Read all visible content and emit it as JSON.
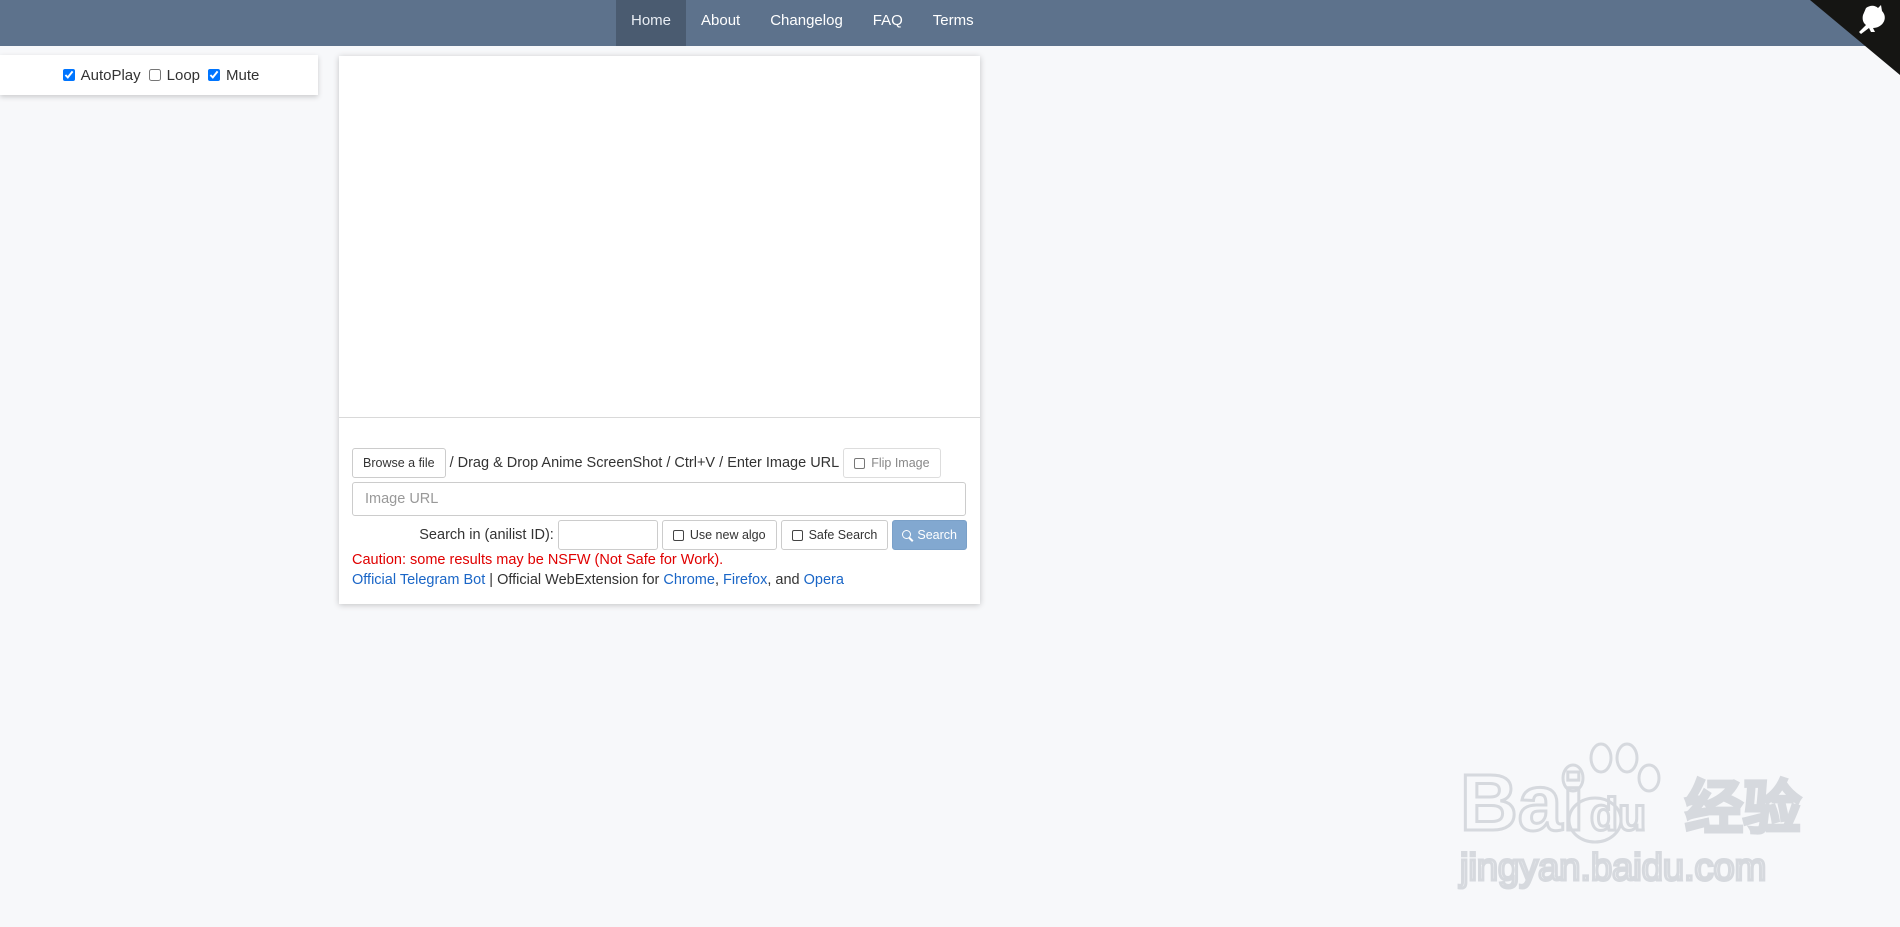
{
  "nav": {
    "items": [
      {
        "label": "Home",
        "active": true
      },
      {
        "label": "About"
      },
      {
        "label": "Changelog"
      },
      {
        "label": "FAQ"
      },
      {
        "label": "Terms"
      }
    ]
  },
  "player_options": {
    "autoplay_label": "AutoPlay",
    "autoplay_checked": true,
    "loop_label": "Loop",
    "loop_checked": false,
    "mute_label": "Mute",
    "mute_checked": true
  },
  "search": {
    "browse_label": "Browse a file",
    "instructions": "/ Drag & Drop Anime ScreenShot / Ctrl+V / Enter Image URL",
    "flip_label": "Flip Image",
    "url_placeholder": "Image URL",
    "anilist_label": "Search in (anilist ID):",
    "new_algo_label": "Use new algo",
    "safe_search_label": "Safe Search",
    "search_button_label": "Search"
  },
  "notices": {
    "caution": "Caution: some results may be NSFW (Not Safe for Work).",
    "telegram_link": "Official Telegram Bot",
    "separator": " | Official WebExtension for ",
    "chrome_link": "Chrome",
    "comma": ", ",
    "firefox_link": "Firefox",
    "and_text": ", and ",
    "opera_link": "Opera"
  },
  "watermark": {
    "brand_text": "Bai",
    "brand_text_2": "du",
    "brand_cn": "经验",
    "domain": "jingyan.baidu.com"
  },
  "colors": {
    "navbar": "#5d728c",
    "nav_active": "#4a5b70",
    "search_button": "#82a8d0",
    "caution": "#e00000",
    "link": "#1a66c7"
  }
}
